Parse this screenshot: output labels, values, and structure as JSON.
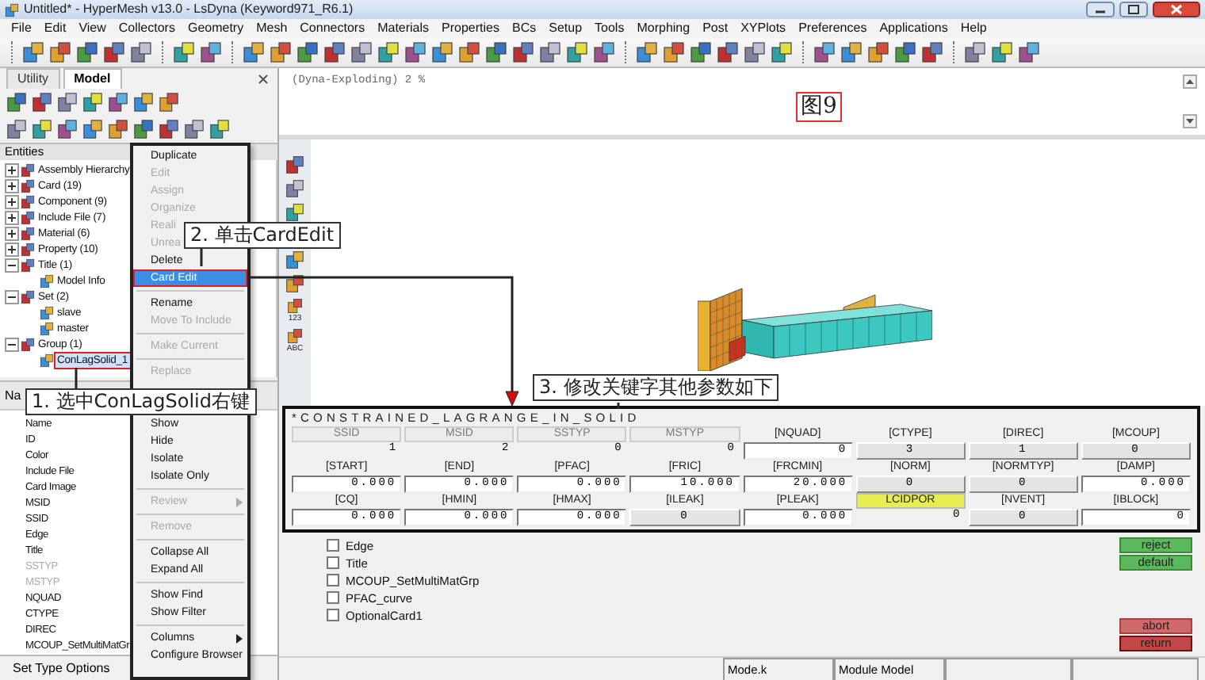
{
  "window": {
    "title": "Untitled* - HyperMesh v13.0 - LsDyna (Keyword971_R6.1)"
  },
  "menu_bar": [
    "File",
    "Edit",
    "View",
    "Collectors",
    "Geometry",
    "Mesh",
    "Connectors",
    "Materials",
    "Properties",
    "BCs",
    "Setup",
    "Tools",
    "Morphing",
    "Post",
    "XYPlots",
    "Preferences",
    "Applications",
    "Help"
  ],
  "left_panel": {
    "tabs": [
      {
        "label": "Utility",
        "selected": false
      },
      {
        "label": "Model",
        "selected": true
      }
    ],
    "entities_title": "Entities",
    "tree": [
      {
        "label": "Assembly Hierarchy",
        "expanded": false,
        "selected": false
      },
      {
        "label": "Card (19)",
        "expanded": false,
        "selected": false
      },
      {
        "label": "Component (9)",
        "expanded": false,
        "selected": false
      },
      {
        "label": "Include File (7)",
        "expanded": false,
        "selected": false
      },
      {
        "label": "Material (6)",
        "expanded": false,
        "selected": false
      },
      {
        "label": "Property (10)",
        "expanded": false,
        "selected": false
      },
      {
        "label": "Title (1)",
        "expanded": true,
        "selected": false,
        "children": [
          {
            "label": "Model Info",
            "selected": false
          }
        ]
      },
      {
        "label": "Set (2)",
        "expanded": true,
        "selected": false,
        "children": [
          {
            "label": "slave",
            "selected": false
          },
          {
            "label": "master",
            "selected": false
          }
        ]
      },
      {
        "label": "Group (1)",
        "expanded": true,
        "selected": false,
        "children": [
          {
            "label": "ConLagSolid_1",
            "selected": true
          }
        ]
      }
    ],
    "properties_header": "Na",
    "properties": [
      {
        "label": "Name",
        "disabled": false
      },
      {
        "label": "ID",
        "disabled": false
      },
      {
        "label": "Color",
        "disabled": false
      },
      {
        "label": "Include File",
        "disabled": false
      },
      {
        "label": "Card Image",
        "disabled": false
      },
      {
        "label": "MSID",
        "disabled": false
      },
      {
        "label": "SSID",
        "disabled": false
      },
      {
        "label": "Edge",
        "disabled": false
      },
      {
        "label": "Title",
        "disabled": false
      },
      {
        "label": "SSTYP",
        "disabled": true
      },
      {
        "label": "MSTYP",
        "disabled": true
      },
      {
        "label": "NQUAD",
        "disabled": false
      },
      {
        "label": "CTYPE",
        "disabled": false
      },
      {
        "label": "DIREC",
        "disabled": false
      },
      {
        "label": "MCOUP_SetMultiMatGr",
        "disabled": false
      }
    ],
    "footer": "Set Type Options"
  },
  "context_menu": [
    {
      "kind": "item",
      "label": "Duplicate",
      "disabled": false,
      "selected": false
    },
    {
      "kind": "item",
      "label": "Edit",
      "disabled": true,
      "selected": false
    },
    {
      "kind": "item",
      "label": "Assign",
      "disabled": true,
      "selected": false
    },
    {
      "kind": "item",
      "label": "Organize",
      "disabled": true,
      "selected": false
    },
    {
      "kind": "item",
      "label": "Reali",
      "disabled": true,
      "selected": false
    },
    {
      "kind": "item",
      "label": "Unrea",
      "disabled": true,
      "selected": false
    },
    {
      "kind": "item",
      "label": "Delete",
      "disabled": false,
      "selected": false
    },
    {
      "kind": "item",
      "label": "Card Edit",
      "disabled": false,
      "selected": true
    },
    {
      "kind": "separator"
    },
    {
      "kind": "item",
      "label": "Rename",
      "disabled": false,
      "selected": false
    },
    {
      "kind": "item",
      "label": "Move To Include",
      "disabled": true,
      "selected": false
    },
    {
      "kind": "separator"
    },
    {
      "kind": "item",
      "label": "Make Current",
      "disabled": true,
      "selected": false
    },
    {
      "kind": "separator"
    },
    {
      "kind": "item",
      "label": "Replace",
      "disabled": true,
      "selected": false
    },
    {
      "kind": "obscured"
    },
    {
      "kind": "item",
      "label": "Show",
      "disabled": false,
      "selected": false
    },
    {
      "kind": "item",
      "label": "Hide",
      "disabled": false,
      "selected": false
    },
    {
      "kind": "item",
      "label": "Isolate",
      "disabled": false,
      "selected": false
    },
    {
      "kind": "item",
      "label": "Isolate Only",
      "disabled": false,
      "selected": false
    },
    {
      "kind": "separator"
    },
    {
      "kind": "submenu",
      "label": "Review",
      "disabled": true,
      "selected": false
    },
    {
      "kind": "separator"
    },
    {
      "kind": "item",
      "label": "Remove",
      "disabled": true,
      "selected": false
    },
    {
      "kind": "separator"
    },
    {
      "kind": "item",
      "label": "Collapse All",
      "disabled": false,
      "selected": false
    },
    {
      "kind": "item",
      "label": "Expand All",
      "disabled": false,
      "selected": false
    },
    {
      "kind": "separator"
    },
    {
      "kind": "item",
      "label": "Show Find",
      "disabled": false,
      "selected": false
    },
    {
      "kind": "item",
      "label": "Show Filter",
      "disabled": false,
      "selected": false
    },
    {
      "kind": "separator"
    },
    {
      "kind": "submenu",
      "label": "Columns",
      "disabled": false,
      "selected": false
    },
    {
      "kind": "item",
      "label": "Configure Browser",
      "disabled": false,
      "selected": false
    }
  ],
  "command_line": {
    "text": "(Dyna-Exploding) 2 %",
    "figure_label": "图9"
  },
  "graphics": {
    "toolbar_labels": [
      "123",
      "ABC"
    ]
  },
  "card_editor": {
    "keyword": "*CONSTRAINED_LAGRANGE_IN_SOLID",
    "rows": [
      [
        {
          "label": {
            "text": "SSID",
            "kind": "disabled"
          },
          "value": {
            "text": "1",
            "kind": "plain"
          }
        },
        {
          "label": {
            "text": "MSID",
            "kind": "disabled"
          },
          "value": {
            "text": "2",
            "kind": "plain"
          }
        },
        {
          "label": {
            "text": "SSTYP",
            "kind": "disabled"
          },
          "value": {
            "text": "0",
            "kind": "plain"
          }
        },
        {
          "label": {
            "text": "MSTYP",
            "kind": "disabled"
          },
          "value": {
            "text": "0",
            "kind": "plain"
          }
        },
        {
          "label": {
            "text": "[NQUAD]",
            "kind": "plain"
          },
          "value": {
            "text": "0",
            "kind": "field"
          }
        },
        {
          "label": {
            "text": "[CTYPE]",
            "kind": "plain"
          },
          "value": {
            "text": "3",
            "kind": "option"
          }
        },
        {
          "label": {
            "text": "[DIREC]",
            "kind": "plain"
          },
          "value": {
            "text": "1",
            "kind": "option"
          }
        },
        {
          "label": {
            "text": "[MCOUP]",
            "kind": "plain"
          },
          "value": {
            "text": "0",
            "kind": "option"
          }
        }
      ],
      [
        {
          "label": {
            "text": "[START]",
            "kind": "plain"
          },
          "value": {
            "text": "0.000",
            "kind": "field"
          }
        },
        {
          "label": {
            "text": "[END]",
            "kind": "plain"
          },
          "value": {
            "text": "0.000",
            "kind": "field"
          }
        },
        {
          "label": {
            "text": "[PFAC]",
            "kind": "plain"
          },
          "value": {
            "text": "0.000",
            "kind": "field"
          }
        },
        {
          "label": {
            "text": "[FRIC]",
            "kind": "plain"
          },
          "value": {
            "text": "10.000",
            "kind": "field"
          }
        },
        {
          "label": {
            "text": "[FRCMIN]",
            "kind": "plain"
          },
          "value": {
            "text": "20.000",
            "kind": "field"
          }
        },
        {
          "label": {
            "text": "[NORM]",
            "kind": "plain"
          },
          "value": {
            "text": "0",
            "kind": "option"
          }
        },
        {
          "label": {
            "text": "[NORMTYP]",
            "kind": "plain"
          },
          "value": {
            "text": "0",
            "kind": "option"
          }
        },
        {
          "label": {
            "text": "[DAMP]",
            "kind": "plain"
          },
          "value": {
            "text": "0.000",
            "kind": "field"
          }
        }
      ],
      [
        {
          "label": {
            "text": "[CQ]",
            "kind": "plain"
          },
          "value": {
            "text": "0.000",
            "kind": "field"
          }
        },
        {
          "label": {
            "text": "[HMIN]",
            "kind": "plain"
          },
          "value": {
            "text": "0.000",
            "kind": "field"
          }
        },
        {
          "label": {
            "text": "[HMAX]",
            "kind": "plain"
          },
          "value": {
            "text": "0.000",
            "kind": "field"
          }
        },
        {
          "label": {
            "text": "[ILEAK]",
            "kind": "plain"
          },
          "value": {
            "text": "0",
            "kind": "option"
          }
        },
        {
          "label": {
            "text": "[PLEAK]",
            "kind": "plain"
          },
          "value": {
            "text": "0.000",
            "kind": "field"
          }
        },
        {
          "label": {
            "text": "LCIDPOR",
            "kind": "highlight"
          },
          "value": {
            "text": "0",
            "kind": "plain"
          }
        },
        {
          "label": {
            "text": "[NVENT]",
            "kind": "plain"
          },
          "value": {
            "text": "0",
            "kind": "option"
          }
        },
        {
          "label": {
            "text": "[IBLOCk]",
            "kind": "plain"
          },
          "value": {
            "text": "0",
            "kind": "field"
          }
        }
      ]
    ]
  },
  "options": [
    {
      "label": "Edge",
      "checked": false
    },
    {
      "label": "Title",
      "checked": false
    },
    {
      "label": "MCOUP_SetMultiMatGrp",
      "checked": false
    },
    {
      "label": "PFAC_curve",
      "checked": false
    },
    {
      "label": "OptionalCard1",
      "checked": false
    }
  ],
  "buttons": [
    {
      "label": "reject",
      "kind": "proceed"
    },
    {
      "label": "default",
      "kind": "proceed"
    },
    {
      "label": "abort",
      "kind": "exit"
    },
    {
      "label": "return",
      "kind": "exit_focused"
    }
  ],
  "status_bar": [
    "Mode.k",
    "Module Model"
  ],
  "annotations": [
    {
      "text": "1. 选中ConLagSolid右键"
    },
    {
      "text": "2. 单击CardEdit"
    },
    {
      "text": "3. 修改关键字其他参数如下"
    }
  ]
}
